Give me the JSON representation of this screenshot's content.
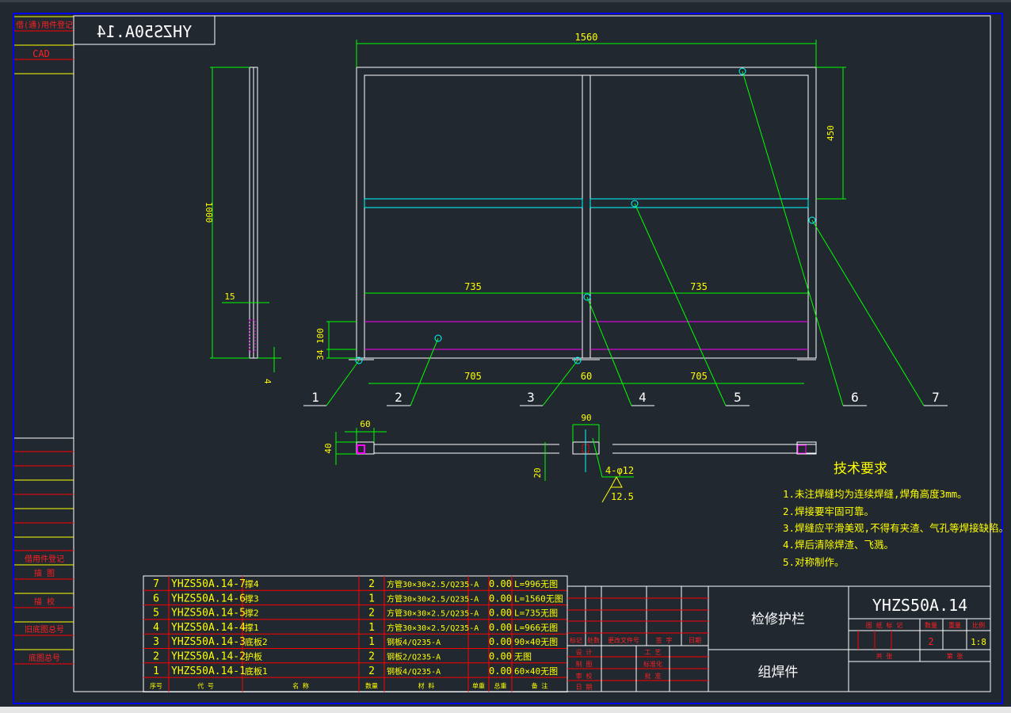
{
  "colors": {
    "background": "#212830",
    "frame": "#ffffff",
    "border": "#0000ff",
    "dimension": "#00ff00",
    "text": "#ffff00",
    "label": "#ff0000",
    "centerline": "#00ffff",
    "hidden": "#ff00ff"
  },
  "sidebar": {
    "top_label": "借(通)用件登记",
    "cad": "CAD",
    "labels": [
      "借用件登记",
      "描 图",
      "描 校",
      "旧底图总号",
      "底图总号"
    ]
  },
  "mirror_code": "YHZS50A.14",
  "dimensions": {
    "width": "1560",
    "height_top": "450",
    "side_height": "1000",
    "side_15": "15",
    "side_4": "4",
    "bottom_34": "34",
    "bottom_100": "100",
    "span_left": "735",
    "span_right": "735",
    "base_left": "705",
    "base_mid": "60",
    "base_right": "705",
    "plate_60": "60",
    "plate_40": "40",
    "plate_90": "90",
    "plate_20": "20",
    "holes": "4-φ12",
    "roughness": "12.5"
  },
  "balloons": [
    "1",
    "2",
    "3",
    "4",
    "5",
    "6",
    "7"
  ],
  "tech": {
    "title": "技术要求",
    "items": [
      "1.未注焊缝均为连续焊缝,焊角高度3mm。",
      "2.焊接要牢固可靠。",
      "3.焊缝应平滑美观,不得有夹渣、气孔等焊接缺陷。",
      "4.焊后清除焊渣、飞溅。",
      "5.对称制作。"
    ]
  },
  "bom": {
    "headers": [
      "序号",
      "代 号",
      "名 称",
      "数量",
      "材 料",
      "单重",
      "总重",
      "备 注"
    ],
    "rows": [
      [
        "7",
        "YHZS50A.14-7",
        "撑4",
        "2",
        "方管30×30×2.5/Q235-A",
        "",
        "0.00",
        "L=996无图"
      ],
      [
        "6",
        "YHZS50A.14-6",
        "撑3",
        "1",
        "方管30×30×2.5/Q235-A",
        "",
        "0.00",
        "L=1560无图"
      ],
      [
        "5",
        "YHZS50A.14-5",
        "撑2",
        "2",
        "方管30×30×2.5/Q235-A",
        "",
        "0.00",
        "L=735无图"
      ],
      [
        "4",
        "YHZS50A.14-4",
        "撑1",
        "1",
        "方管30×30×2.5/Q235-A",
        "",
        "0.00",
        "L=966无图"
      ],
      [
        "3",
        "YHZS50A.14-3",
        "底板2",
        "1",
        "钢板4/Q235-A",
        "",
        "0.00",
        "90×40无图"
      ],
      [
        "2",
        "YHZS50A.14-2",
        "护板",
        "2",
        "钢板2/Q235-A",
        "",
        "0.00",
        "无图"
      ],
      [
        "1",
        "YHZS50A.14-1",
        "底板1",
        "2",
        "钢板4/Q235-A",
        "",
        "0.00",
        "60×40无图"
      ]
    ]
  },
  "title_block": {
    "rev_headers": [
      "标记",
      "处数",
      "更改文件号",
      "签 字",
      "日期"
    ],
    "sign_left": [
      "设 计",
      "制 图",
      "审 校",
      "日 期"
    ],
    "sign_right": [
      "工 艺",
      "标准化",
      "批 准"
    ],
    "name": "检修护栏",
    "type": "组焊件",
    "code": "YHZS50A.14",
    "info_headers": [
      "图 纸 标 记",
      "数量",
      "重量",
      "比例"
    ],
    "quantity": "2",
    "scale": "1:8",
    "sheets_total": "共 张",
    "sheet_no": "第 张"
  }
}
